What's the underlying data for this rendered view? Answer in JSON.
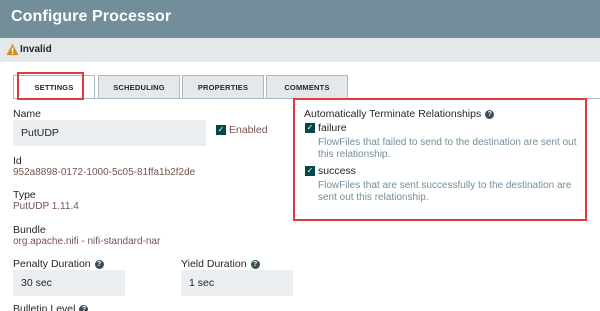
{
  "dialog": {
    "title": "Configure Processor"
  },
  "status": {
    "icon": "warning-icon",
    "text": "Invalid",
    "warning_color": "#d98c1e"
  },
  "tabs": [
    {
      "label": "SETTINGS",
      "active": true
    },
    {
      "label": "SCHEDULING",
      "active": false
    },
    {
      "label": "PROPERTIES",
      "active": false
    },
    {
      "label": "COMMENTS",
      "active": false
    }
  ],
  "settings": {
    "name_label": "Name",
    "name_value": "PutUDP",
    "enabled_label": "Enabled",
    "enabled_checked": true,
    "id_label": "Id",
    "id_value": "952a8898-0172-1000-5c05-81ffa1b2f2de",
    "type_label": "Type",
    "type_value": "PutUDP 1.11.4",
    "bundle_label": "Bundle",
    "bundle_value": "org.apache.nifi - nifi-standard-nar",
    "penalty_label": "Penalty Duration",
    "penalty_value": "30 sec",
    "yield_label": "Yield Duration",
    "yield_value": "1 sec",
    "bulletin_label": "Bulletin Level"
  },
  "relationships": {
    "title": "Automatically Terminate Relationships",
    "items": [
      {
        "name": "failure",
        "checked": true,
        "description": "FlowFiles that failed to send to the destination are sent out this relationship."
      },
      {
        "name": "success",
        "checked": true,
        "description": "FlowFiles that are sent successfully to the destination are sent out this relationship."
      }
    ]
  },
  "colors": {
    "header": "#728e9b",
    "statusbar": "#e3e8eb",
    "highlight": "#e23b3b",
    "value_text": "#775351",
    "checkbox": "#004849"
  }
}
